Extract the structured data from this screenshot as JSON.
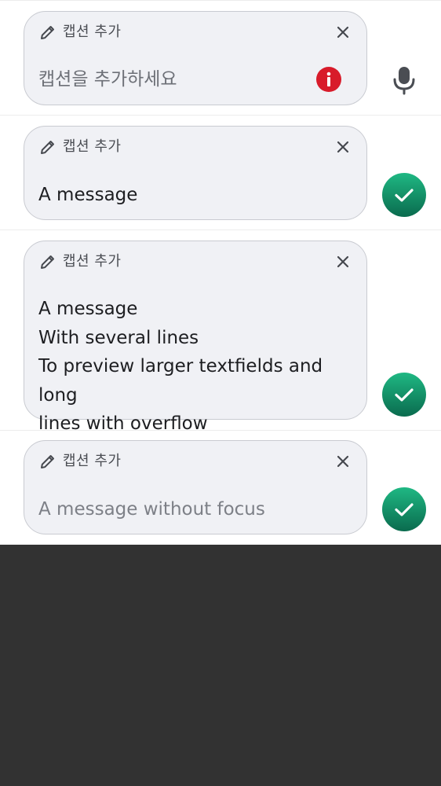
{
  "accent_color": "#128d63",
  "error_color": "#d81b2a",
  "rows": [
    {
      "title": "캡션 추가",
      "text": "",
      "placeholder": "캡션을 추가하세요",
      "state": "empty-error",
      "trailing_action": "mic-icon"
    },
    {
      "title": "캡션 추가",
      "text": "A message",
      "state": "focused",
      "trailing_action": "send-check-icon"
    },
    {
      "title": "캡션 추가",
      "text": "A message\nWith several lines\nTo preview larger textfields and long\nlines with overflow",
      "state": "focused",
      "trailing_action": "send-check-icon"
    },
    {
      "title": "캡션 추가",
      "text": "A message without focus",
      "state": "unfocused",
      "trailing_action": "send-check-icon"
    }
  ]
}
